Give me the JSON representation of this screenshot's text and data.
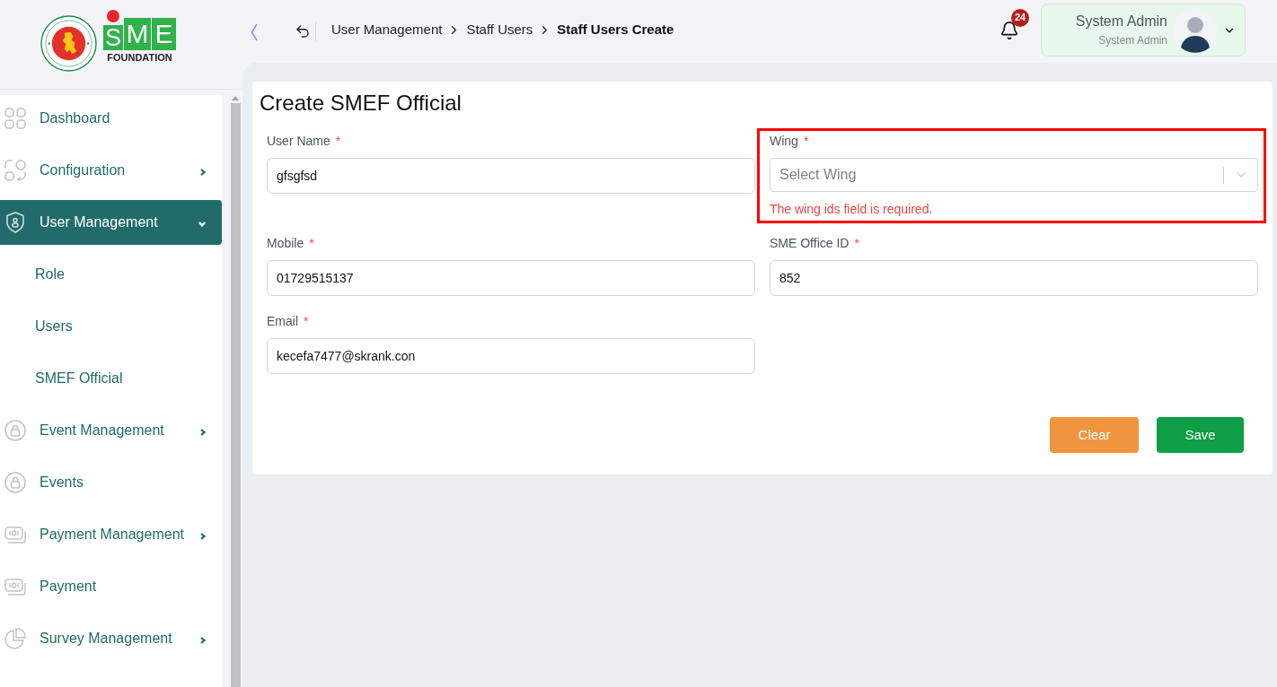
{
  "logo": {
    "letters": [
      "S",
      "M",
      "E"
    ],
    "subtitle": "FOUNDATION"
  },
  "header": {
    "breadcrumb": [
      {
        "label": "User Management",
        "current": false
      },
      {
        "label": "Staff Users",
        "current": false
      },
      {
        "label": "Staff Users Create",
        "current": true
      }
    ],
    "notifications": {
      "count": "24"
    },
    "user": {
      "name": "System Admin",
      "role": "System Admin"
    }
  },
  "sidebar": {
    "items": [
      {
        "label": "Dashboard",
        "selected": false
      },
      {
        "label": "Configuration",
        "selected": false,
        "expanded": false
      },
      {
        "label": "User Management",
        "selected": true,
        "expanded": true,
        "children": [
          {
            "label": "Role",
            "selected": false
          },
          {
            "label": "Users",
            "selected": false
          },
          {
            "label": "SMEF Official",
            "selected": false
          }
        ]
      },
      {
        "label": "Event Management",
        "selected": false,
        "expanded": false
      },
      {
        "label": "Events",
        "selected": false
      },
      {
        "label": "Payment Management",
        "selected": false,
        "expanded": false
      },
      {
        "label": "Payment",
        "selected": false
      },
      {
        "label": "Survey Management",
        "selected": false,
        "expanded": false
      }
    ]
  },
  "form": {
    "title": "Create SMEF Official",
    "fields": [
      {
        "label": "User Name",
        "mark": "*",
        "kind": "text",
        "value": "gfsgfsd"
      },
      {
        "label": "Wing",
        "mark": "*",
        "kind": "select",
        "placeholder": "Select Wing",
        "error": "The wing ids field is required.",
        "highlighted": true
      },
      {
        "label": "Mobile",
        "mark": "*",
        "kind": "text",
        "value": "01729515137"
      },
      {
        "label": "SME Office ID",
        "mark": "*",
        "kind": "text",
        "value": "852"
      },
      {
        "label": "Email",
        "mark": "*",
        "kind": "text",
        "value": "kecefa7477@skrank.con"
      }
    ],
    "buttons": [
      {
        "label": "Clear",
        "kind": "secondary"
      },
      {
        "label": "Save",
        "kind": "primary"
      }
    ]
  }
}
